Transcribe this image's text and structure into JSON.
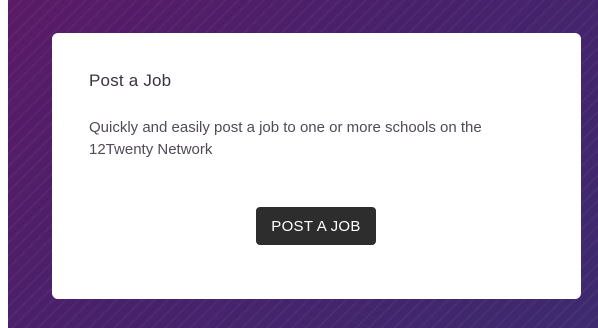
{
  "card": {
    "title": "Post a Job",
    "description": "Quickly and easily post a job to one or more schools on the 12Twenty Network",
    "button_label": "POST A JOB"
  },
  "colors": {
    "background_primary": "#5a1a66",
    "background_secondary": "#3d2a6e",
    "card_background": "#ffffff",
    "button_background": "#2d2d2d",
    "button_text": "#ffffff"
  }
}
